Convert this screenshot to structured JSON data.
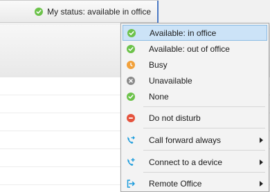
{
  "status_button": {
    "label": "My status: available in office",
    "icon": "check-circle-icon"
  },
  "menu": {
    "items": [
      {
        "label": "Available: in office",
        "icon": "check-circle-icon",
        "color": "#6cc24a",
        "selected": true
      },
      {
        "label": "Available: out of office",
        "icon": "check-circle-icon",
        "color": "#6cc24a"
      },
      {
        "label": "Busy",
        "icon": "clock-icon",
        "color": "#f2a13b"
      },
      {
        "label": "Unavailable",
        "icon": "x-circle-icon",
        "color": "#8a8a8a"
      },
      {
        "label": "None",
        "icon": "check-circle-icon",
        "color": "#6cc24a"
      },
      {
        "label": "Do not disturb",
        "icon": "minus-circle-icon",
        "color": "#e5533d"
      },
      {
        "label": "Call forward always",
        "icon": "phone-forward-icon",
        "color": "#1a9bdc",
        "submenu": true
      },
      {
        "label": "Connect to a device",
        "icon": "phone-add-icon",
        "color": "#1a9bdc",
        "submenu": true
      },
      {
        "label": "Remote Office",
        "icon": "remote-office-icon",
        "color": "#1a9bdc",
        "submenu": true
      }
    ]
  }
}
